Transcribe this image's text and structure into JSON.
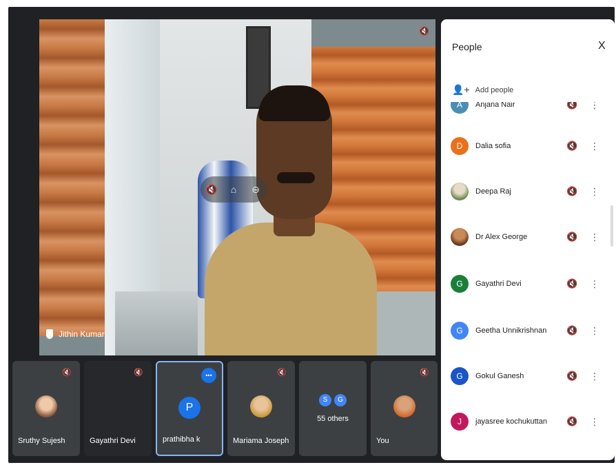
{
  "main_video": {
    "presenter_name": "Jithin Kumar",
    "hover_controls": [
      "mic-off",
      "pin",
      "more"
    ]
  },
  "tiles": [
    {
      "name": "Sruthy Sujesh",
      "type": "photo",
      "muted": true
    },
    {
      "name": "Gayathri Devi",
      "type": "dark",
      "muted": true
    },
    {
      "name": "prathibha k",
      "type": "letter",
      "letter": "P",
      "speaking": true
    },
    {
      "name": "Mariama Joseph",
      "type": "photo",
      "muted": true
    },
    {
      "name": "55 others",
      "type": "others",
      "avatars": [
        "S",
        "G"
      ]
    },
    {
      "name": "You",
      "type": "photo",
      "muted": true
    }
  ],
  "panel": {
    "title": "People",
    "close": "X",
    "add_people": "Add people",
    "participants": [
      {
        "name": "Anjana Nair",
        "initial": "A",
        "color": "#4a8fb3",
        "partial": true
      },
      {
        "name": "Dalia sofia",
        "initial": "D",
        "color": "#e8711a"
      },
      {
        "name": "Deepa Raj",
        "initial": "",
        "color": "#7a8f6a",
        "photo": true
      },
      {
        "name": "Dr Alex George",
        "initial": "",
        "color": "#a0522d",
        "photo": true
      },
      {
        "name": "Gayathri Devi",
        "initial": "G",
        "color": "#188038"
      },
      {
        "name": "Geetha Unnikrishnan",
        "initial": "G",
        "color": "#4285f4"
      },
      {
        "name": "Gokul Ganesh",
        "initial": "G",
        "color": "#1a56c9"
      },
      {
        "name": "jayasree kochukuttan",
        "initial": "J",
        "color": "#c2185b"
      }
    ]
  }
}
